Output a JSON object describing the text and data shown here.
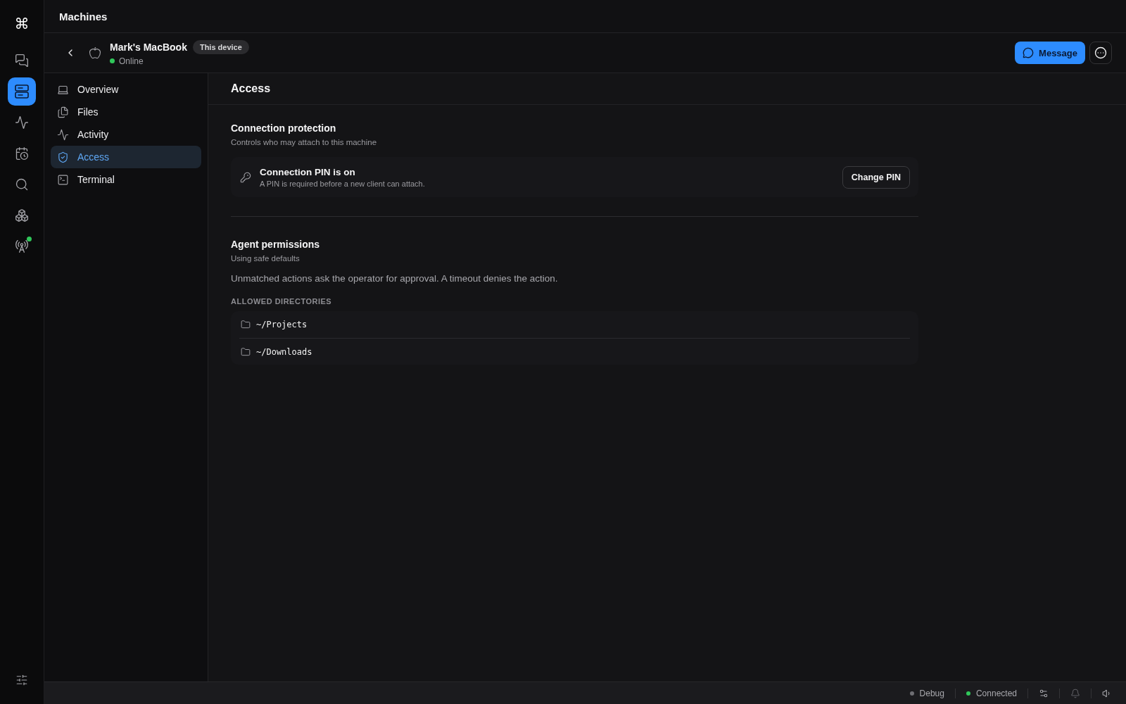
{
  "rail": {
    "logo": "⌘",
    "items": [
      {
        "selected": false,
        "indicator": false
      },
      {
        "selected": true,
        "indicator": false
      },
      {
        "selected": false,
        "indicator": false
      },
      {
        "selected": false,
        "indicator": false
      },
      {
        "selected": false,
        "indicator": false
      },
      {
        "selected": false,
        "indicator": false
      },
      {
        "selected": false,
        "indicator": true
      }
    ]
  },
  "top_bar": {
    "title": "Machines"
  },
  "device": {
    "name": "Mark's MacBook",
    "badge": "This device",
    "status": "Online",
    "online": true,
    "message_button": "Message"
  },
  "nav": [
    {
      "label": "Overview",
      "selected": false
    },
    {
      "label": "Files",
      "selected": false
    },
    {
      "label": "Activity",
      "selected": false
    },
    {
      "label": "Access",
      "selected": true
    },
    {
      "label": "Terminal",
      "selected": false
    }
  ],
  "panel": {
    "title": "Access",
    "connection_protection": {
      "title": "Connection protection",
      "subtitle": "Controls who may attach to this machine",
      "pin": {
        "title": "Connection PIN is on",
        "description": "A PIN is required before a new client can attach.",
        "button": "Change PIN"
      }
    },
    "agent_permissions": {
      "title": "Agent permissions",
      "subtitle": "Using safe defaults",
      "description": "Unmatched actions ask the operator for approval. A timeout denies the action.",
      "directories_label": "ALLOWED DIRECTORIES",
      "directories": [
        "~/Projects",
        "~/Downloads"
      ]
    }
  },
  "status_bar": {
    "items": [
      {
        "label": "Debug",
        "color": "#6e6e73"
      },
      {
        "label": "Connected",
        "color": "#30c75a"
      }
    ]
  }
}
